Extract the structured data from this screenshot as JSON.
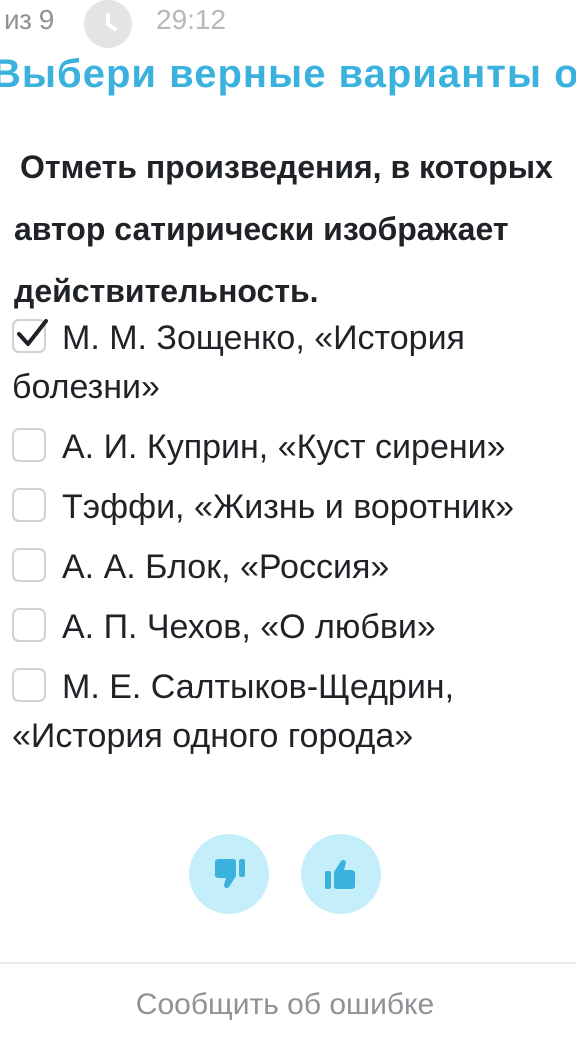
{
  "header": {
    "question_counter": "из 9",
    "timer_icon": "clock-icon",
    "timer_value": "29:12"
  },
  "instruction": "Выбери верные варианты ответа",
  "question": {
    "line1": "Отметь произведения, в которых",
    "line2": "автор сатирически изображает",
    "line3": "действительность."
  },
  "options": [
    {
      "label": "М. М. Зощенко, «История болезни»",
      "checked": true
    },
    {
      "label": "А. И. Куприн, «Куст сирени»",
      "checked": false
    },
    {
      "label": "Тэффи, «Жизнь и воротник»",
      "checked": false
    },
    {
      "label": "А. А. Блок, «Россия»",
      "checked": false
    },
    {
      "label": "А. П. Чехов, «О любви»",
      "checked": false
    },
    {
      "label": "М. Е. Салтыков-Щедрин, «История одного города»",
      "checked": false
    }
  ],
  "feedback": {
    "dislike_icon": "thumbs-down-icon",
    "like_icon": "thumbs-up-icon",
    "accent_color": "#3ab2dd",
    "button_bg": "#c5eefb"
  },
  "footer": {
    "report_label": "Сообщить об ошибке"
  }
}
